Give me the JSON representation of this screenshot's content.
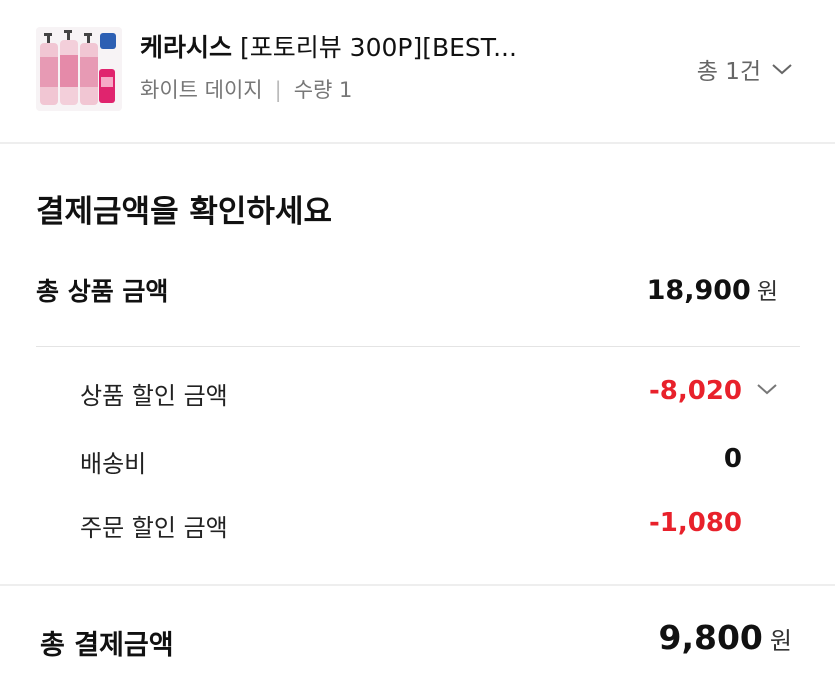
{
  "product": {
    "brand": "케라시스",
    "title_rest": " [포토리뷰 300P][BEST...",
    "option": "화이트 데이지",
    "separator": "|",
    "quantity": "수량 1",
    "total_count": "총 1건"
  },
  "payment": {
    "section_title": "결제금액을 확인하세요",
    "total_product_label": "총 상품 금액",
    "total_product_amount": "18,900",
    "currency": "원",
    "product_discount_label": "상품 할인 금액",
    "product_discount_amount": "-8,020",
    "shipping_label": "배송비",
    "shipping_amount": "0",
    "order_discount_label": "주문 할인 금액",
    "order_discount_amount": "-1,080",
    "grand_total_label": "총 결제금액",
    "grand_total_amount": "9,800"
  },
  "colors": {
    "discount_red": "#e8212b",
    "divider": "#eeeeee",
    "muted_text": "#777777"
  }
}
